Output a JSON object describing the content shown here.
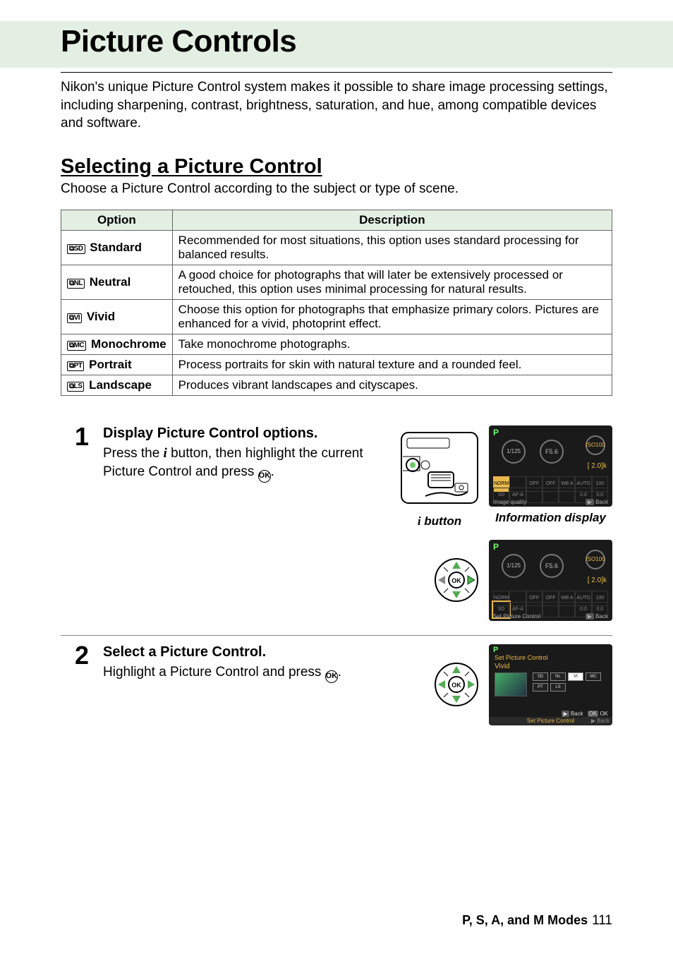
{
  "title": "Picture Controls",
  "intro": "Nikon's unique Picture Control system makes it possible to share image processing settings, including sharpening, contrast, brightness, saturation, and hue, among compatible devices and software.",
  "section_heading": "Selecting a Picture Control",
  "section_intro": "Choose a Picture Control according to the subject or type of scene.",
  "table": {
    "head_option": "Option",
    "head_desc": "Description",
    "rows": [
      {
        "code": "SD",
        "name": "Standard",
        "desc": "Recommended for most situations, this option uses standard processing for balanced results."
      },
      {
        "code": "NL",
        "name": "Neutral",
        "desc": "A good choice for photographs that will later be extensively processed or retouched, this option uses minimal processing for natural results."
      },
      {
        "code": "VI",
        "name": "Vivid",
        "desc": "Choose this option for photographs that emphasize primary colors. Pictures are enhanced for a vivid, photoprint effect."
      },
      {
        "code": "MC",
        "name": "Monochrome",
        "desc": "Take monochrome photographs."
      },
      {
        "code": "PT",
        "name": "Portrait",
        "desc": "Process portraits for skin with natural texture and a rounded feel."
      },
      {
        "code": "LS",
        "name": "Landscape",
        "desc": "Produces vibrant landscapes and cityscapes."
      }
    ]
  },
  "steps": {
    "s1": {
      "num": "1",
      "title": "Display Picture Control options.",
      "body_a": "Press the ",
      "body_b": " button, then highlight the current Picture Control and press ",
      "body_c": ".",
      "cap_left": " button",
      "cap_right": "Information display"
    },
    "s2": {
      "num": "2",
      "title": "Select a Picture Control.",
      "body_a": "Highlight a Picture Control and press ",
      "body_b": "."
    }
  },
  "lcd": {
    "mode": "P",
    "shutter": "125",
    "shutter_prefix": "1/",
    "aperture": "5.6",
    "aperture_prefix": "F",
    "iso_label": "ISO",
    "iso": "100",
    "expo": "[ 2.0]k",
    "row1": [
      "NORM",
      "",
      "OFF",
      "OFF",
      "WB A",
      "AUTO",
      "100"
    ],
    "row2": [
      "SD",
      "AF-A",
      "",
      "",
      "",
      "0.0",
      "0.0"
    ],
    "foot_left": "Image quality",
    "foot_right": "Back",
    "foot_left2": "Set Picture Control"
  },
  "lcd_select": {
    "mode": "P",
    "title": "Set Picture Control",
    "sub": "Vivid",
    "chips": [
      "SD",
      "NL",
      "VI",
      "MC",
      "PT",
      "LS"
    ],
    "selected_index": 2,
    "back": "Back",
    "ok": "OK",
    "foot": "Set Picture Control",
    "foot_back": "Back"
  },
  "glyphs": {
    "i": "i",
    "ok": "OK"
  },
  "footer": {
    "section": "P, S, A, and M Modes",
    "page": "111"
  }
}
